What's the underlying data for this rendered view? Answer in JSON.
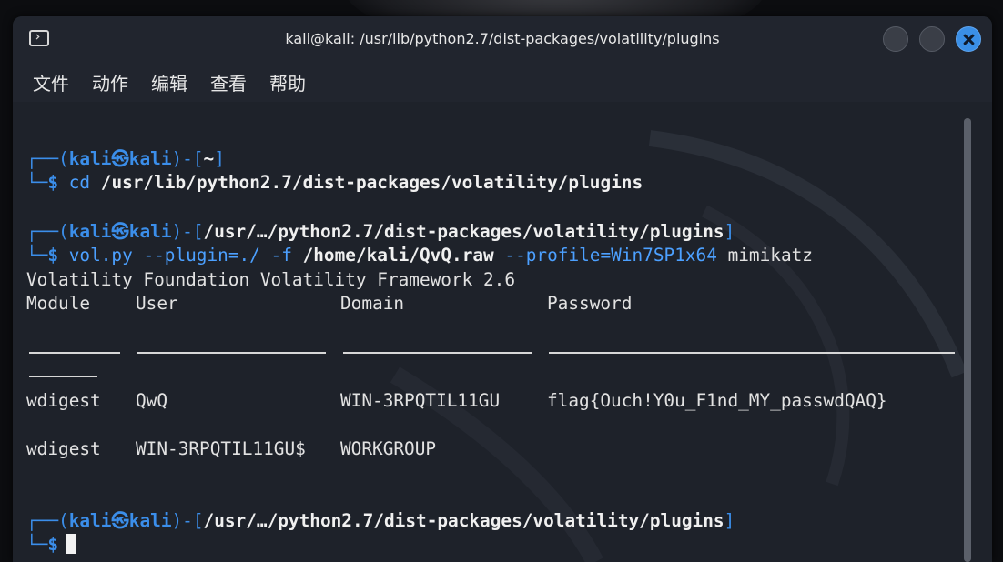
{
  "window": {
    "title": "kali@kali: /usr/lib/python2.7/dist-packages/volatility/plugins"
  },
  "menu": {
    "items": [
      "文件",
      "动作",
      "编辑",
      "查看",
      "帮助"
    ]
  },
  "terminal": {
    "prompt1": {
      "user": "kali",
      "at_glyph": "㉿",
      "host": "kali",
      "path": "~",
      "command": "cd",
      "argument": "/usr/lib/python2.7/dist-packages/volatility/plugins"
    },
    "prompt2": {
      "user": "kali",
      "at_glyph": "㉿",
      "host": "kali",
      "path": "/usr/…/python2.7/dist-packages/volatility/plugins",
      "cmd_part1": "vol.py --plugin=./ -f",
      "file_arg": "/home/kali/QvQ.raw",
      "flag_part": "--profile=Win7SP1x64",
      "plugin": "mimikatz"
    },
    "output": {
      "banner": "Volatility Foundation Volatility Framework 2.6",
      "headers": [
        "Module",
        "User",
        "Domain",
        "Password"
      ],
      "rows": [
        [
          "wdigest",
          "QwQ",
          "WIN-3RPQTIL11GU",
          "flag{Ouch!Y0u_F1nd_MY_passwdQAQ}"
        ],
        [
          "wdigest",
          "WIN-3RPQTIL11GU$",
          "WORKGROUP",
          ""
        ]
      ]
    },
    "prompt3": {
      "user": "kali",
      "at_glyph": "㉿",
      "host": "kali",
      "path": "/usr/…/python2.7/dist-packages/volatility/plugins"
    },
    "colors": {
      "background": "#1e222a",
      "prompt_blue": "#3b8eea",
      "text": "#e2e2e2"
    }
  }
}
